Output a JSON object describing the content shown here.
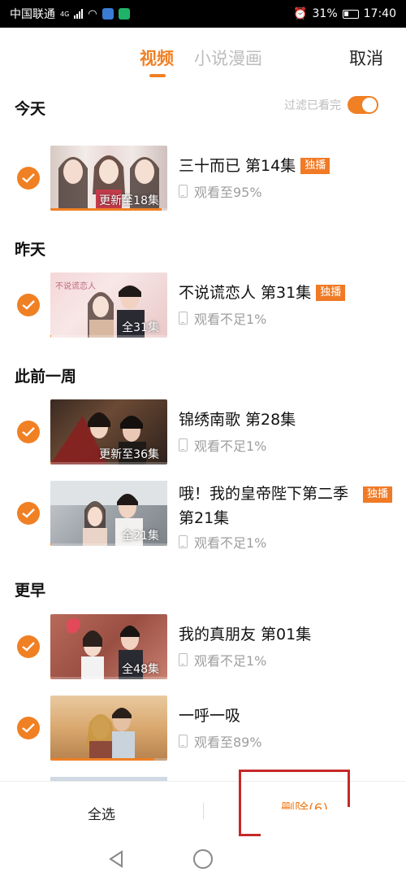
{
  "status_bar": {
    "carrier": "中国联通",
    "network": "4G",
    "battery_percent": "31%",
    "time": "17:40"
  },
  "header": {
    "tabs": [
      {
        "label": "视频",
        "active": true
      },
      {
        "label": "小说漫画",
        "active": false
      }
    ],
    "cancel_label": "取消"
  },
  "filter": {
    "label": "过滤已看完",
    "enabled": true
  },
  "sections": [
    {
      "title": "今天"
    },
    {
      "title": "昨天"
    },
    {
      "title": "此前一周"
    },
    {
      "title": "更早"
    }
  ],
  "items": [
    {
      "title": "三十而已 第14集",
      "badge": "独播",
      "overlay": "更新至18集",
      "watch": "观看至95%",
      "progress": 0.95,
      "checked": true
    },
    {
      "title": "不说谎恋人 第31集",
      "badge": "独播",
      "overlay": "全31集",
      "watch": "观看不足1%",
      "progress": 0.01,
      "checked": true
    },
    {
      "title": "锦绣南歌 第28集",
      "badge": "",
      "overlay": "更新至36集",
      "watch": "观看不足1%",
      "progress": 0.01,
      "checked": true
    },
    {
      "title": "哦！我的皇帝陛下第二季 第21集",
      "badge": "独播",
      "overlay": "全21集",
      "watch": "观看不足1%",
      "progress": 0.01,
      "checked": true
    },
    {
      "title": "我的真朋友 第01集",
      "badge": "",
      "overlay": "全48集",
      "watch": "观看不足1%",
      "progress": 0.01,
      "checked": true
    },
    {
      "title": "一呼一吸",
      "badge": "",
      "overlay": "",
      "watch": "观看至89%",
      "progress": 0.89,
      "checked": true
    }
  ],
  "bottom_bar": {
    "select_all_label": "全选",
    "delete_label": "删除(6)"
  },
  "colors": {
    "accent": "#f08024",
    "highlight": "#c62828"
  }
}
